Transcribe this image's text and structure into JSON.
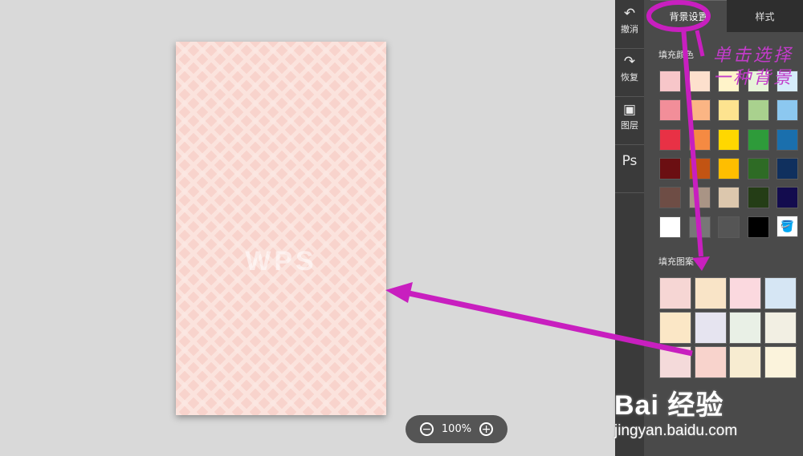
{
  "toolbar": {
    "undo_label": "撤消",
    "redo_label": "恢复",
    "layers_label": "图层",
    "ps_label": "Ps"
  },
  "panel": {
    "tabs": [
      {
        "label": "背景设置",
        "active": true
      },
      {
        "label": "样式",
        "active": false
      }
    ],
    "fill_color_title": "填充颜色",
    "fill_pattern_title": "填充图案",
    "colors": [
      [
        "#f7c6c9",
        "#fde0cd",
        "#fff3c9",
        "#e7f4d9",
        "#d6ecfb"
      ],
      [
        "#f28e99",
        "#fbb584",
        "#fde38f",
        "#a9d18e",
        "#8cc8f0"
      ],
      [
        "#e83145",
        "#f58a42",
        "#ffd700",
        "#2e9b3a",
        "#1a6fad"
      ],
      [
        "#6b0f12",
        "#c25413",
        "#ffbe00",
        "#2e6b25",
        "#10305e"
      ],
      [
        "#6e4d45",
        "#a99485",
        "#dcc7ad",
        "#243d16",
        "#130c4e"
      ],
      [
        "#ffffff",
        "#777777",
        "#555555",
        "#000000"
      ]
    ],
    "patterns": [
      [
        "#f6d6d4",
        "#f9e4c7",
        "#fbd9df",
        "#d6e6f4"
      ],
      [
        "#fbe7c6",
        "#e6e4f0",
        "#e9f0e6",
        "#f2efe3"
      ],
      [
        "#f4dada",
        "#f8d3cc",
        "#f7ecd1",
        "#fbf3dc"
      ]
    ]
  },
  "canvas": {
    "watermark": "WPS"
  },
  "zoom": {
    "value": "100%",
    "minus": "−",
    "plus": "+"
  },
  "annotation": {
    "line1": "单击选择",
    "line2": "一种背景"
  },
  "watermark": {
    "logo": "Bai 经验",
    "url": "jingyan.baidu.com"
  }
}
